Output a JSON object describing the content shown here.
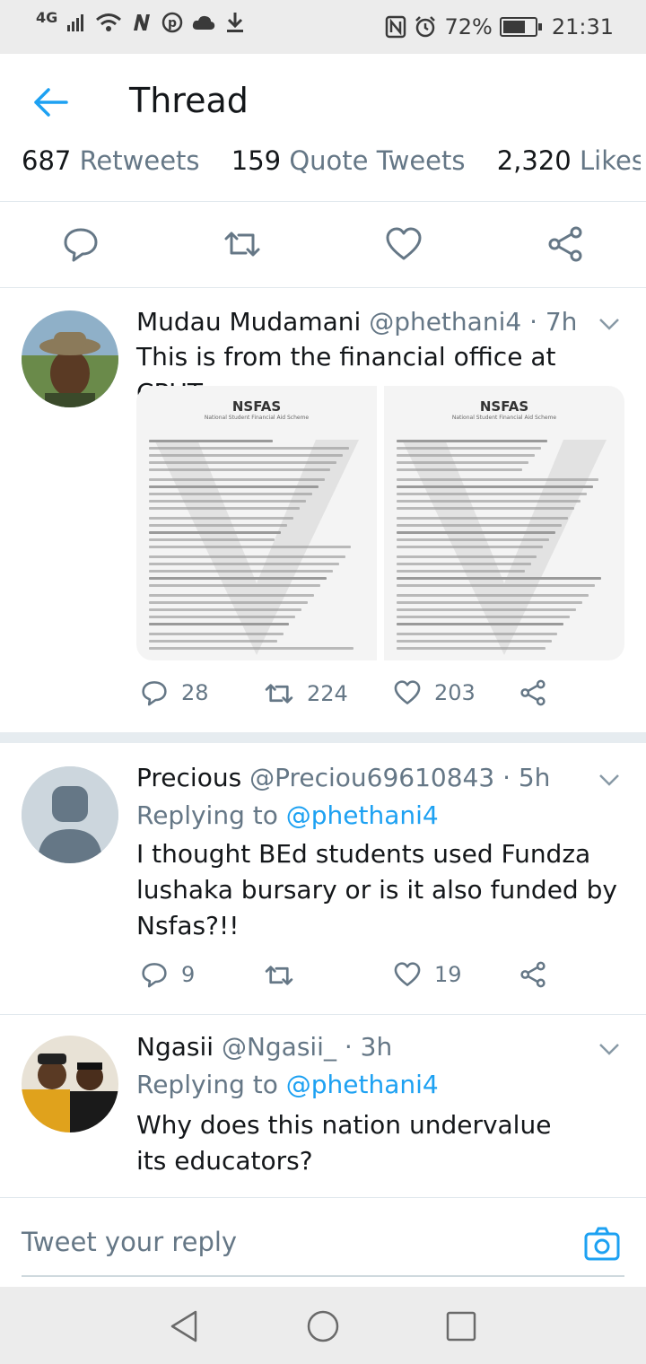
{
  "status_bar": {
    "network": "4G",
    "nfc": "N",
    "battery": "72%",
    "battery_level": 0.72,
    "time": "21:31"
  },
  "app_bar": {
    "title": "Thread"
  },
  "stats": {
    "retweets_count": "687",
    "retweets_label": "Retweets",
    "quotes_count": "159",
    "quotes_label": "Quote Tweets",
    "likes_count": "2,320",
    "likes_label": "Likes"
  },
  "tweets": [
    {
      "name": "Mudau Mudamani",
      "handle": "@phethani4",
      "time": "· 7h",
      "text": "This is from the financial office at CPUT",
      "images": [
        {
          "logo": "NSFAS",
          "caption": "National Student Financial Aid Scheme"
        },
        {
          "logo": "NSFAS",
          "caption": "National Student Financial Aid Scheme"
        }
      ],
      "replies": "28",
      "retweets": "224",
      "likes": "203"
    },
    {
      "name": "Precious",
      "handle": "@Preciou69610843",
      "time": "· 5h",
      "replying_prefix": "Replying to ",
      "replying_to": "@phethani4",
      "text": "I thought BEd students used Fundza lushaka bursary or is it also funded by Nsfas?!!",
      "replies": "9",
      "retweets": "",
      "likes": "19"
    },
    {
      "name": "Ngasii",
      "handle": "@Ngasii_",
      "time": "· 3h",
      "replying_prefix": "Replying to ",
      "replying_to": "@phethani4",
      "text": "Why does this nation undervalue its educators?"
    }
  ],
  "reply_box": {
    "placeholder": "Tweet your reply"
  },
  "colors": {
    "accent": "#1da1f2",
    "secondary_text": "#657786",
    "primary_text": "#14171a"
  }
}
